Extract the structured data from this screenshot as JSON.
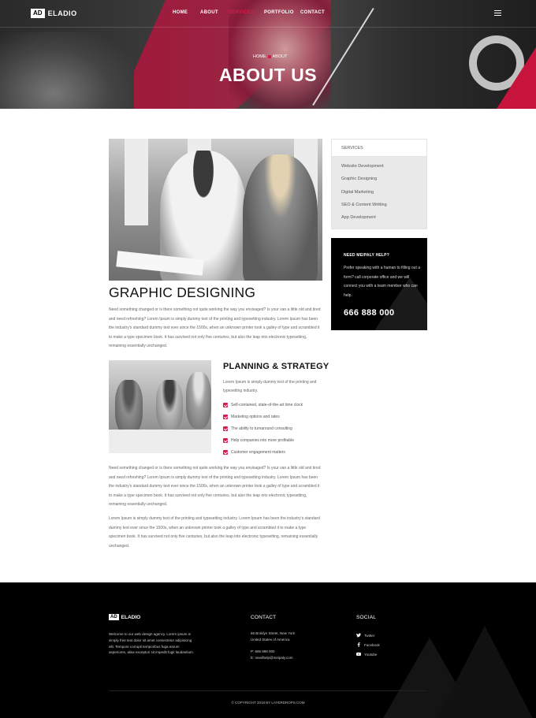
{
  "header": {
    "logo_box": "AD",
    "logo_name": "ELADIO",
    "nav": [
      "HOME",
      "ABOUT",
      "SERVICES",
      "PORTFOLIO",
      "CONTACT"
    ],
    "active_nav": "SERVICES",
    "accent_color": "#d8194a"
  },
  "hero": {
    "breadcrumb": [
      "HOME",
      "ABOUT"
    ],
    "title": "ABOUT US"
  },
  "main": {
    "heading": "GRAPHIC DESIGNING",
    "paragraph1": "Need something changed or is there something not quite working the way you envisaged? Is your van a little old and tired and need refreshing? Lorem Ipsum is simply dummy text of the printing and typesetting industry. Lorem Ipsum has been the industry's standard dummy text ever since the 1500s, when an unknown printer took a galley of type and scrambled it to make a type specimen book. It has survived not only five centuries, but also the leap into electronic typesetting, remaining essentially unchanged.",
    "plan_heading": "PLANNING & STRATEGY",
    "plan_intro": "Lorem Ipsum is simply dummy text of the printing and typesetting industry.",
    "checklist": [
      "Self-contained, state-of-the-art time clock",
      "Marketing options and rates",
      "The ability to turnaround consulting",
      "Help companies into more profitable",
      "Customer engagement matters"
    ],
    "paragraph2": "Need something changed or is there something not quite working the way you envisaged? Is your van a little old and tired and need refreshing? Lorem Ipsum is simply dummy text of the printing and typesetting industry. Lorem Ipsum has been the industry's standard dummy text ever since the 1500s, when an unknown printer took a galley of type and scrambled it to make a type specimen book. It has survived not only five centuries, but also the leap into electronic typesetting, remaining essentially unchanged.",
    "paragraph3": "Lorem Ipsum is simply dummy text of the printing and typesetting industry. Lorem Ipsum has been the industry's standard dummy text ever since the 1500s, when an unknown printer took a galley of type and scrambled it to make a type specimen book. It has survived not only five centuries, but also the leap into electronic typesetting, remaining essentially unchanged."
  },
  "sidebar": {
    "services_title": "SERVICES",
    "services": [
      "Website Development",
      "Graphic Designing",
      "Digital Marketing",
      "SEO & Content Writting",
      "App Development"
    ],
    "help_title": "NEED MEIPALY HELP?",
    "help_text": "Prefer speaking with a human to filling out a form? call corporate office and we will connect you with a team member who can help.",
    "help_phone": "666 888 000"
  },
  "footer": {
    "logo_box": "AD",
    "logo_name": "ELADIO",
    "about": "Welcome to our web design agency. Lorem ipsum is simply free text dolor sit amet consectetur adipisicing elit. Tempore corrupti temporibus fuga earum asperiores, alias excepturi sit impedit fugit laudantium.",
    "contact_title": "CONTACT",
    "address_line1": "66 Broklyn Street, New York",
    "address_line2": "United States of America",
    "phone": "P: 666 888 000",
    "email": "E: needhelp@meipaly.com",
    "social_title": "SOCIAL",
    "social": [
      "Twitter",
      "Facebook",
      "Youtube"
    ],
    "copyright": "© COPYRIGHT 2018 BY LAYERDROPS.COM"
  }
}
